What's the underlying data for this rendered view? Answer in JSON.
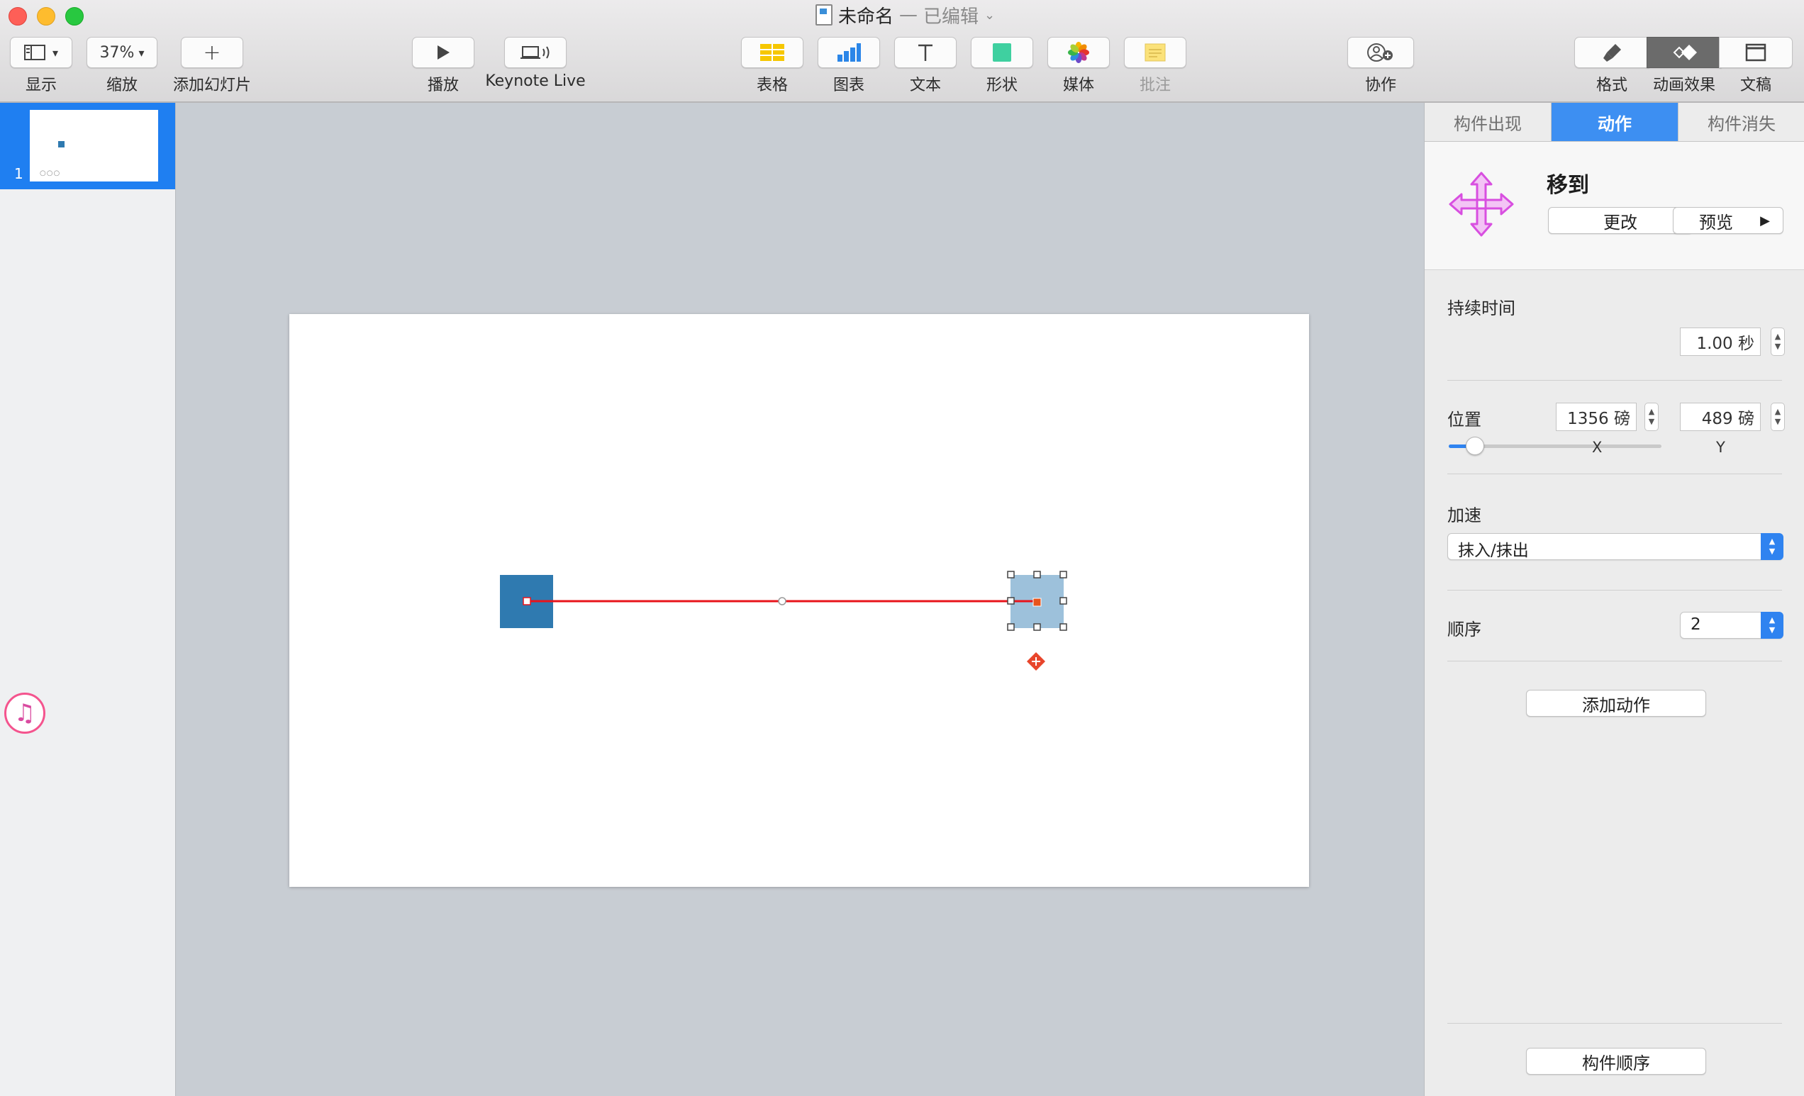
{
  "window": {
    "title": "未命名",
    "separator": "—",
    "edited_status": "已编辑"
  },
  "toolbar": {
    "view_label": "显示",
    "zoom_value": "37%",
    "zoom_label": "缩放",
    "add_slide_label": "添加幻灯片",
    "play_label": "播放",
    "keynote_live_label": "Keynote Live",
    "table_label": "表格",
    "chart_label": "图表",
    "text_label": "文本",
    "shape_label": "形状",
    "media_label": "媒体",
    "comment_label": "批注",
    "collaborate_label": "协作",
    "format_label": "格式",
    "animate_label": "动画效果",
    "document_label": "文稿"
  },
  "navigator": {
    "slide_number": "1",
    "thumb_dots": "○○○"
  },
  "inspector": {
    "tabs": [
      {
        "label": "构件出现",
        "active": false
      },
      {
        "label": "动作",
        "active": true
      },
      {
        "label": "构件消失",
        "active": false
      }
    ],
    "action": {
      "name": "移到",
      "change_label": "更改",
      "preview_label": "预览"
    },
    "duration": {
      "label": "持续时间",
      "value": "1.00 秒",
      "slider_fraction": 0.12
    },
    "position": {
      "label": "位置",
      "x_value": "1356 磅",
      "y_value": "489 磅",
      "x_label": "X",
      "y_label": "Y"
    },
    "acceleration": {
      "label": "加速",
      "value": "抹入/抹出"
    },
    "order": {
      "label": "顺序",
      "value": "2"
    },
    "add_action_label": "添加动作",
    "build_order_label": "构件顺序"
  },
  "colors": {
    "accent": "#2f83f0",
    "shape_start": "#2f7ab0",
    "shape_ghost": "#9dc1db",
    "motion_path": "#e8141b",
    "move_icon": "#d84fe0"
  }
}
